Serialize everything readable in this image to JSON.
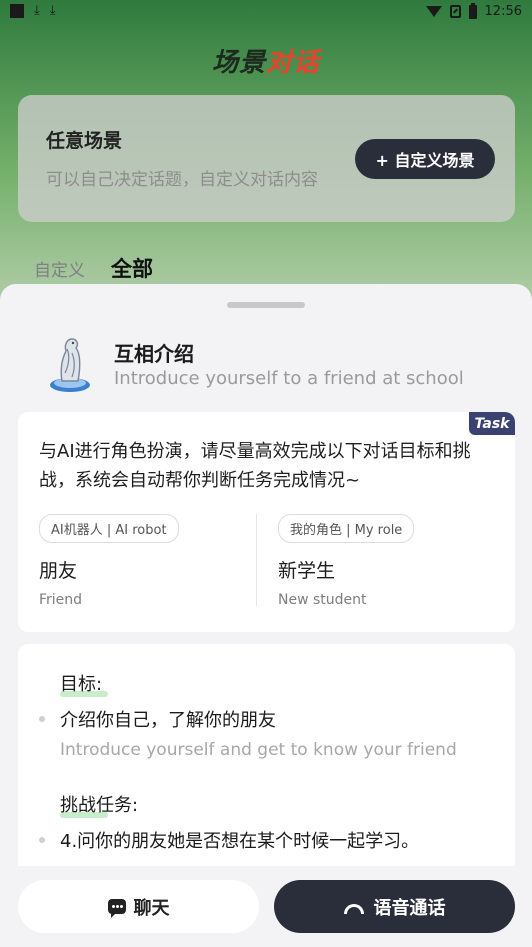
{
  "status_bar": {
    "time": "12:56",
    "download_glyph": "⤓"
  },
  "app_title": {
    "part1": "场景",
    "part2": "对话"
  },
  "any_scene": {
    "title": "任意场景",
    "subtitle": "可以自己决定话题，自定义对话内容",
    "custom_button": "+ 自定义场景"
  },
  "tabs": [
    {
      "label": "自定义",
      "active": false
    },
    {
      "label": "全部",
      "active": true
    }
  ],
  "scenario": {
    "name": "互相介绍",
    "name_en": "Introduce yourself to a friend at school"
  },
  "task": {
    "badge": "Task",
    "description": "与AI进行角色扮演，请尽量高效完成以下对话目标和挑战，系统会自动帮你判断任务完成情况~",
    "ai_role": {
      "tag": "AI机器人 | AI robot",
      "cn": "朋友",
      "en": "Friend"
    },
    "my_role": {
      "tag": "我的角色 | My role",
      "cn": "新学生",
      "en": "New student"
    }
  },
  "goals": {
    "goal_title": "目标:",
    "goal_cn": "介绍你自己，了解你的朋友",
    "goal_en": "Introduce yourself and get to know your friend",
    "challenge_title": "挑战任务:",
    "challenge_item": "4.问你的朋友她是否想在某个时候一起学习。"
  },
  "actions": {
    "chat": "聊天",
    "voice": "语音通话"
  },
  "colors": {
    "dark_button": "#2a2d3a",
    "title_accent": "#e8432c",
    "task_badge": "#3a4272",
    "underline": "#c7edcb"
  }
}
